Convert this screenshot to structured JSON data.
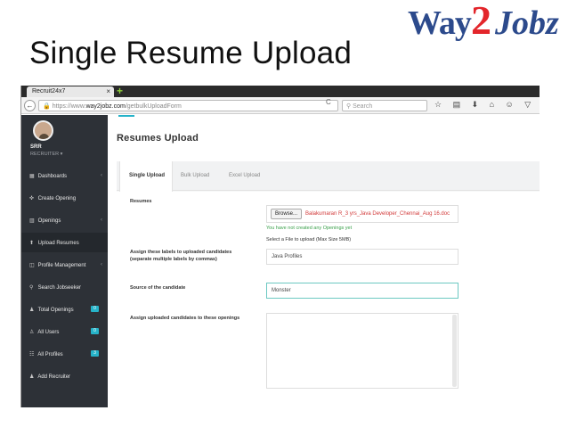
{
  "slide": {
    "title": "Single Resume Upload",
    "logo": {
      "part1": "Way",
      "part2": "2",
      "part3": "Jobz"
    }
  },
  "browser": {
    "tab_title": "Recruit24x7",
    "tab_close": "×",
    "new_tab": "+",
    "url_prefix": "https://www.",
    "url_host": "way2jobz.com",
    "url_path": "/getbulkUploadForm",
    "search_placeholder": "Search",
    "reload_icon": "C",
    "toolbar_icons": "☆ ▤ ⬇ ⌂ ☺ ▽ ⚙"
  },
  "sidebar": {
    "user_name": "SRR",
    "user_role": "RECRUITER ▾",
    "items": [
      {
        "label": "Dashboards",
        "icon": "▦",
        "chevron": "‹",
        "badge": ""
      },
      {
        "label": "Create Opening",
        "icon": "✜",
        "chevron": "",
        "badge": ""
      },
      {
        "label": "Openings",
        "icon": "▥",
        "chevron": "‹",
        "badge": ""
      },
      {
        "label": "Upload Resumes",
        "icon": "⬆",
        "chevron": "",
        "badge": ""
      },
      {
        "label": "Profile Management",
        "icon": "◫",
        "chevron": "‹",
        "badge": ""
      },
      {
        "label": "Search Jobseeker",
        "icon": "⚲",
        "chevron": "",
        "badge": ""
      },
      {
        "label": "Total Openings",
        "icon": "♟",
        "chevron": "",
        "badge": "0"
      },
      {
        "label": "All Users",
        "icon": "♙",
        "chevron": "",
        "badge": "0"
      },
      {
        "label": "All Profiles",
        "icon": "☷",
        "chevron": "",
        "badge": "3"
      },
      {
        "label": "Add Recruiter",
        "icon": "♟",
        "chevron": "",
        "badge": ""
      }
    ]
  },
  "main": {
    "heading": "Resumes Upload",
    "tabs": [
      "Single Upload",
      "Bulk Upload",
      "Excel Upload"
    ],
    "form": {
      "resumes_label": "Resumes",
      "browse_label": "Browse...",
      "file_name": "Balakumaran R_3 yrs_Java Developer_Chennai_Aug 16.doc",
      "no_openings_msg": "You have not created any Openings yet",
      "file_note": "Select a File to upload (Max Size 5MB)",
      "labels_label_1": "Assign these labels to uploaded candidates",
      "labels_label_2": "(separate multiple labels by commas)",
      "labels_value": "Java Profiles",
      "source_label": "Source of the candidate",
      "source_value": "Monster",
      "openings_label": "Assign uploaded candidates to these openings"
    }
  },
  "colors": {
    "sidebar_bg": "#2d3137",
    "badge": "#26b3c9",
    "logo_blue": "#2c4a8c",
    "logo_red": "#e3262b",
    "error_red": "#d23a3a",
    "help_green": "#3aa04a"
  }
}
